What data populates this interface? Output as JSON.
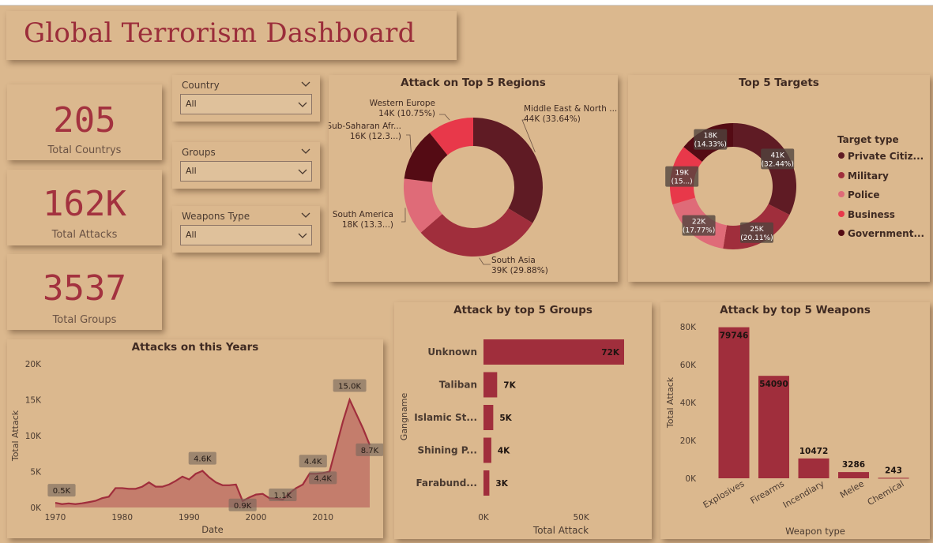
{
  "dashboard": {
    "title": "Global Terrorism Dashboard"
  },
  "kpis": [
    {
      "value": "205",
      "label": "Total Countrys"
    },
    {
      "value": "162K",
      "label": "Total Attacks"
    },
    {
      "value": "3537",
      "label": "Total Groups"
    }
  ],
  "slicers": [
    {
      "label": "Country",
      "value": "All"
    },
    {
      "label": "Groups",
      "value": "All"
    },
    {
      "label": "Weapons Type",
      "value": "All"
    }
  ],
  "colors": {
    "background": "#dbb88e",
    "accent": "#a3323f",
    "title": "#9b2d3a"
  },
  "chart_data": [
    {
      "type": "pie",
      "variant": "donut",
      "title": "Attack on Top 5 Regions",
      "slices": [
        {
          "label": "Middle East & North ...",
          "value_label": "44K (33.64%)",
          "value": 44,
          "percent": 33.64,
          "color": "#5f1b24"
        },
        {
          "label": "South Asia",
          "value_label": "39K (29.88%)",
          "value": 39,
          "percent": 29.88,
          "color": "#a02e3c"
        },
        {
          "label": "South America",
          "value_label": "18K (13.3...)",
          "value": 18,
          "percent": 13.3,
          "color": "#df6b78"
        },
        {
          "label": "Sub-Saharan Afr...",
          "value_label": "16K (12.3...)",
          "value": 16,
          "percent": 12.3,
          "color": "#540b14"
        },
        {
          "label": "Western Europe",
          "value_label": "14K (10.75%)",
          "value": 14,
          "percent": 10.75,
          "color": "#e8384a"
        }
      ]
    },
    {
      "type": "pie",
      "variant": "donut",
      "title": "Top 5 Targets",
      "legend_title": "Target type",
      "legend_position": "right",
      "slices": [
        {
          "label": "Private Citiz...",
          "value_label": "41K (32.44%)",
          "value": 41,
          "percent": 32.44,
          "color": "#5f1b24"
        },
        {
          "label": "Military",
          "value_label": "25K (20.11%)",
          "value": 25,
          "percent": 20.11,
          "color": "#a02e3c"
        },
        {
          "label": "Police",
          "value_label": "22K (17.77%)",
          "value": 22,
          "percent": 17.77,
          "color": "#df6b78"
        },
        {
          "label": "Business",
          "value_label": "19K (15...)",
          "value": 19,
          "percent": 15.34,
          "color": "#e8384a"
        },
        {
          "label": "Government...",
          "value_label": "18K (14.33%)",
          "value": 18,
          "percent": 14.33,
          "color": "#540b14"
        }
      ]
    },
    {
      "type": "bar",
      "orientation": "horizontal",
      "title": "Attack by top 5 Groups",
      "xlabel": "Total Attack",
      "ylabel": "Gangname",
      "xlim": [
        0,
        72000
      ],
      "xticks": [
        {
          "value": 0,
          "label": "0K"
        },
        {
          "value": 50000,
          "label": "50K"
        }
      ],
      "categories": [
        "Unknown",
        "Taliban",
        "Islamic St...",
        "Shining P...",
        "Farabund..."
      ],
      "values": [
        72000,
        7000,
        5000,
        4000,
        3000
      ],
      "data_labels": [
        "72K",
        "7K",
        "5K",
        "4K",
        "3K"
      ],
      "color": "#a02e3c"
    },
    {
      "type": "bar",
      "orientation": "vertical",
      "title": "Attack by top 5 Weapons",
      "xlabel": "Weapon type",
      "ylabel": "Total Attack",
      "ylim": [
        0,
        80000
      ],
      "yticks": [
        {
          "value": 0,
          "label": "0K"
        },
        {
          "value": 20000,
          "label": "20K"
        },
        {
          "value": 40000,
          "label": "40K"
        },
        {
          "value": 60000,
          "label": "60K"
        },
        {
          "value": 80000,
          "label": "80K"
        }
      ],
      "categories": [
        "Explosives",
        "Firearms",
        "Incendiary",
        "Melee",
        "Chemical"
      ],
      "values": [
        79746,
        54090,
        10472,
        3286,
        243
      ],
      "data_labels": [
        "79746",
        "54090",
        "10472",
        "3286",
        "243"
      ],
      "color": "#a02e3c"
    },
    {
      "type": "area",
      "title": "Attacks on this Years",
      "xlabel": "Date",
      "ylabel": "Total Attack",
      "xlim": [
        1970,
        2017
      ],
      "ylim": [
        0,
        20000
      ],
      "xticks": [
        {
          "value": 1970,
          "label": "1970"
        },
        {
          "value": 1980,
          "label": "1980"
        },
        {
          "value": 1990,
          "label": "1990"
        },
        {
          "value": 2000,
          "label": "2000"
        },
        {
          "value": 2010,
          "label": "2010"
        }
      ],
      "yticks": [
        {
          "value": 0,
          "label": "0K"
        },
        {
          "value": 5000,
          "label": "5K"
        },
        {
          "value": 10000,
          "label": "10K"
        },
        {
          "value": 15000,
          "label": "15K"
        },
        {
          "value": 20000,
          "label": "20K"
        }
      ],
      "x": [
        1970,
        1971,
        1972,
        1973,
        1974,
        1975,
        1976,
        1977,
        1978,
        1979,
        1980,
        1981,
        1982,
        1983,
        1984,
        1985,
        1986,
        1987,
        1988,
        1989,
        1990,
        1991,
        1992,
        1993,
        1994,
        1995,
        1996,
        1997,
        1998,
        1999,
        2000,
        2001,
        2002,
        2003,
        2004,
        2005,
        2006,
        2007,
        2008,
        2009,
        2010,
        2011,
        2012,
        2013,
        2014,
        2015,
        2016,
        2017
      ],
      "values": [
        650,
        470,
        570,
        470,
        580,
        740,
        920,
        1300,
        1500,
        2700,
        2700,
        2600,
        2600,
        2900,
        3500,
        2900,
        2900,
        3200,
        3700,
        4300,
        3900,
        4700,
        5100,
        4200,
        3500,
        3100,
        3100,
        3200,
        900,
        1400,
        1800,
        1900,
        1300,
        1250,
        1100,
        2000,
        2700,
        3200,
        4700,
        4700,
        4800,
        5000,
        8500,
        12000,
        15000,
        13000,
        11000,
        8700
      ],
      "data_labels": [
        {
          "x": 1970,
          "label": "0.5K"
        },
        {
          "x": 1992,
          "label": "4.6K"
        },
        {
          "x": 1998,
          "label": "0.9K"
        },
        {
          "x": 2004,
          "label": "1.1K"
        },
        {
          "x": 2009,
          "label": "4.4K"
        },
        {
          "x": 2010,
          "label": "4.4K"
        },
        {
          "x": 2014,
          "label": "15.0K"
        },
        {
          "x": 2017,
          "label": "8.7K"
        }
      ],
      "color": "#a02e3c"
    }
  ]
}
